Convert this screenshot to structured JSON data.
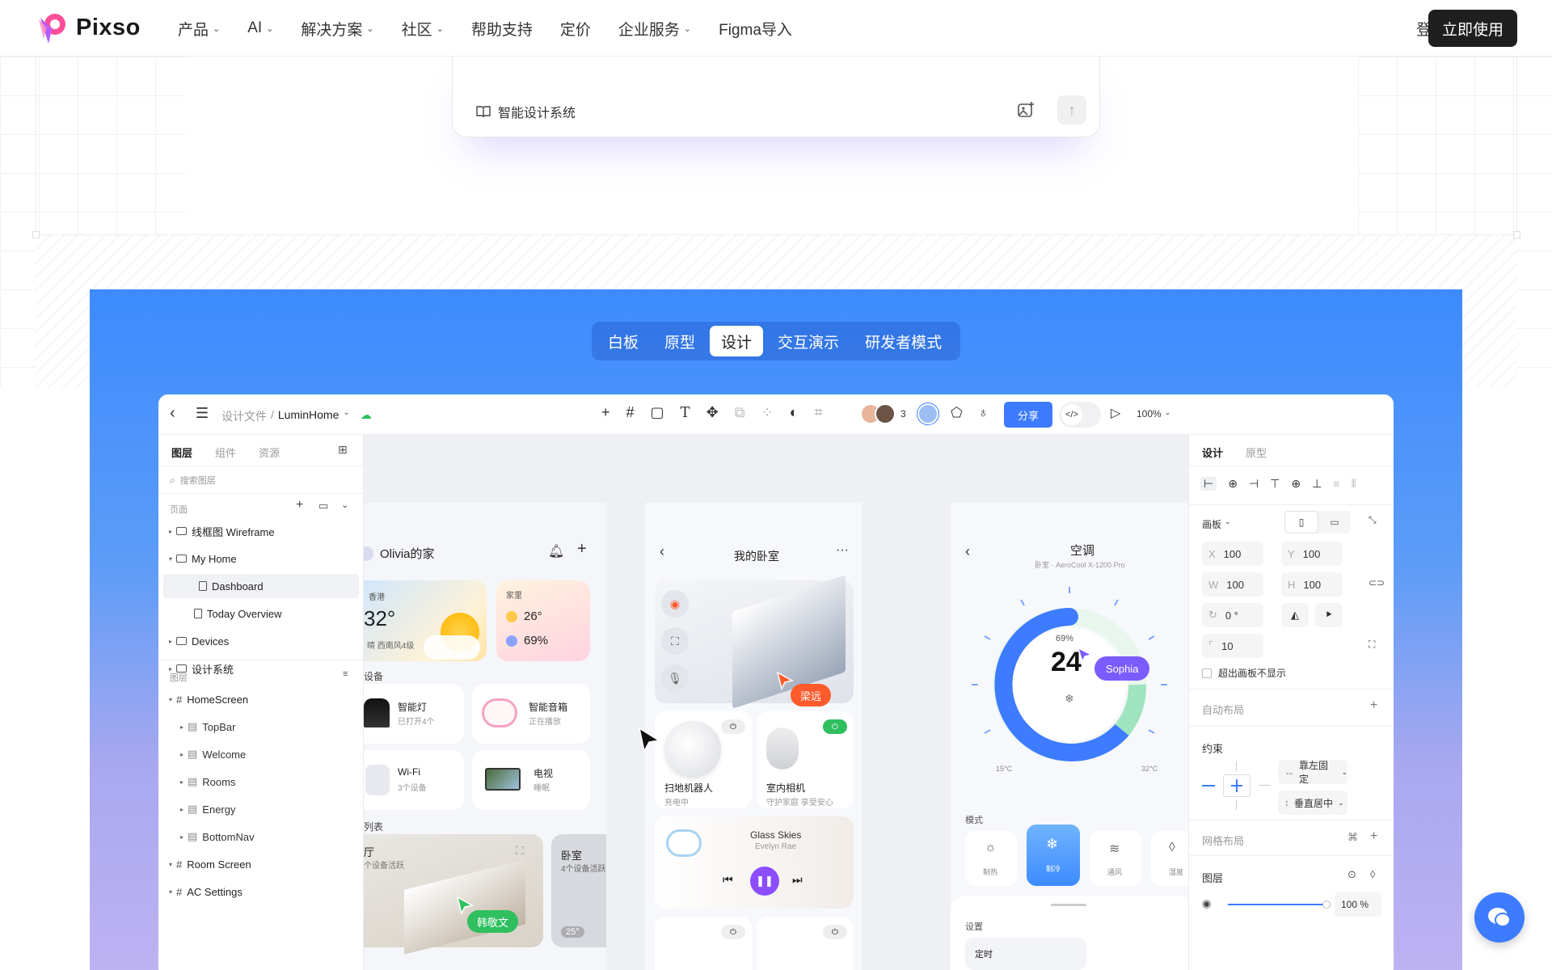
{
  "nav": {
    "brand": "Pixso",
    "items": [
      "产品",
      "AI",
      "解决方案",
      "社区",
      "帮助支持",
      "定价",
      "企业服务",
      "Figma导入"
    ],
    "login": "登录",
    "cta": "立即使用"
  },
  "prompt": {
    "design_system_label": "智能设计系统"
  },
  "mode_tabs": [
    "白板",
    "原型",
    "设计",
    "交互演示",
    "研发者模式"
  ],
  "mode_active": "设计",
  "editor": {
    "breadcrumb_prefix": "设计文件",
    "breadcrumb_sep": "/",
    "file_name": "LuminHome",
    "collab_count": "3",
    "share": "分享",
    "zoom": "100%",
    "left_tabs": [
      "图层",
      "组件",
      "资源"
    ],
    "search_placeholder": "搜索图层",
    "pages_title": "页面",
    "pages": [
      {
        "label": "线框图 Wireframe",
        "kind": "folder",
        "open": false,
        "indent": 0
      },
      {
        "label": "My Home",
        "kind": "folder",
        "open": true,
        "indent": 0
      },
      {
        "label": "Dashboard",
        "kind": "doc",
        "indent": 1,
        "selected": true
      },
      {
        "label": "Today Overview",
        "kind": "doc",
        "indent": 1
      },
      {
        "label": "Devices",
        "kind": "folder",
        "open": false,
        "indent": 0
      },
      {
        "label": "设计系统",
        "kind": "folder",
        "open": false,
        "indent": 0
      }
    ],
    "layers_title": "图层",
    "layers": [
      {
        "label": "HomeScreen",
        "kind": "frame",
        "indent": 0,
        "open": true
      },
      {
        "label": "TopBar",
        "kind": "group",
        "indent": 1
      },
      {
        "label": "Welcome",
        "kind": "group",
        "indent": 1
      },
      {
        "label": "Rooms",
        "kind": "group",
        "indent": 1
      },
      {
        "label": "Energy",
        "kind": "group",
        "indent": 1
      },
      {
        "label": "BottomNav",
        "kind": "group",
        "indent": 1
      },
      {
        "label": "Room Screen",
        "kind": "frame",
        "indent": 0,
        "open": true
      },
      {
        "label": "AC Settings",
        "kind": "frame",
        "indent": 0,
        "open": true
      }
    ],
    "right_tabs": [
      "设计",
      "原型"
    ],
    "artboard_label": "画板",
    "x": "100",
    "y": "100",
    "w": "100",
    "h": "100",
    "rotation": "0 °",
    "radius": "10",
    "clip_label": "超出画板不显示",
    "auto_layout": "自动布局",
    "constraints": "约束",
    "constraint_h": "靠左固定",
    "constraint_v": "垂直居中",
    "grid_layout": "网格布局",
    "layer_section": "图层",
    "opacity": "100 %"
  },
  "home_frame": {
    "title": "Olivia的家",
    "weather_city": "香港",
    "weather_temp": "32°",
    "weather_desc": "晴 西南风4级",
    "home_label": "家里",
    "home_temp": "26°",
    "home_humidity": "69%",
    "devices_title": "设备",
    "devices": [
      {
        "name": "智能灯",
        "status": "已打开4个"
      },
      {
        "name": "智能音箱",
        "status": "正在播放"
      },
      {
        "name": "Wi-Fi",
        "status": "3个设备"
      },
      {
        "name": "电视",
        "status": "睡眠"
      }
    ],
    "rooms_title": "列表",
    "room1_name": "厅",
    "room1_sub": "个设备活跃",
    "room2_name": "卧室",
    "room2_sub": "4个设备活跃",
    "room2_temp": "25°",
    "collaborator": "韩敬文"
  },
  "room_frame": {
    "title": "我的卧室",
    "robot_name": "扫地机器人",
    "robot_status": "充电中",
    "camera_name": "室内相机",
    "camera_status": "守护家庭 享受安心",
    "music_title": "Glass Skies",
    "music_artist": "Evelyn Rae",
    "collaborator": "梁远"
  },
  "ac_frame": {
    "title": "空调",
    "subtitle": "卧室 · AeroCool X-1200 Pro",
    "humidity": "69%",
    "temp": "24",
    "min": "15°C",
    "max": "32°C",
    "mode_label": "模式",
    "modes": [
      "制热",
      "制冷",
      "通风",
      "湿度"
    ],
    "settings_label": "设置",
    "timer_label": "定时",
    "collaborator": "Sophia"
  },
  "colors": {
    "accent": "#3d7bff",
    "collab_orange": "#ff5a2c",
    "collab_green": "#2fbf5f",
    "collab_purple": "#7b5cff"
  }
}
